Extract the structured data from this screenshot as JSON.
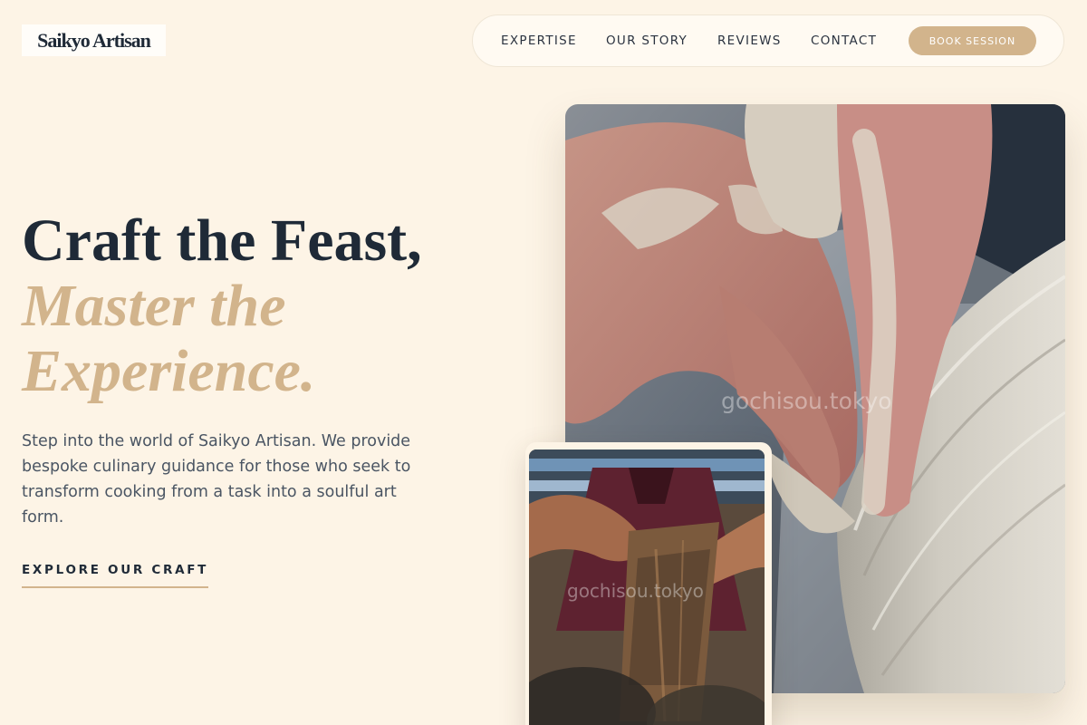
{
  "brand": {
    "logo_text": "Saikyo Artisan"
  },
  "nav": {
    "items": [
      "EXPERTISE",
      "OUR STORY",
      "REVIEWS",
      "CONTACT"
    ],
    "cta_label": "BOOK SESSION"
  },
  "hero": {
    "headline_line1": "Craft the Feast,",
    "headline_accent": "Master the Experience.",
    "lead": "Step into the world of Saikyo Artisan. We provide bespoke culinary guidance for those who seek to transform cooking from a task into a soulful art form.",
    "cta_label": "EXPLORE OUR CRAFT"
  },
  "images": {
    "main": {
      "subject": "hands shaping clay on a pottery wheel",
      "watermark": "gochisou.tokyo"
    },
    "secondary": {
      "subject": "artisan hands carving wood in a workshop",
      "watermark": "gochisou.tokyo"
    }
  },
  "colors": {
    "background": "#fdf4e6",
    "accent": "#d2b48c",
    "heading": "#1f2a37",
    "body_text": "#4a5563"
  }
}
